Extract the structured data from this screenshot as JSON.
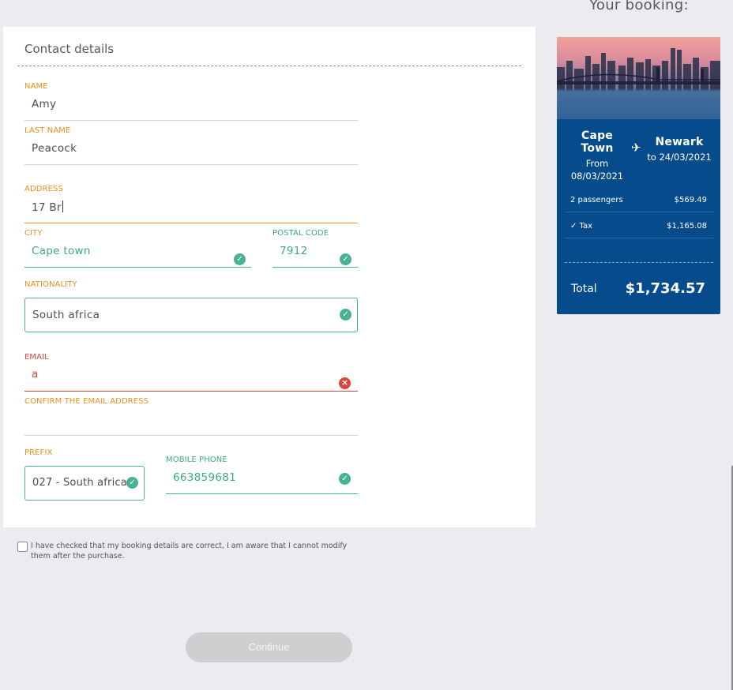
{
  "form": {
    "title": "Contact details",
    "name": {
      "label": "NAME",
      "value": "Amy"
    },
    "last_name": {
      "label": "LAST NAME",
      "value": "Peacock"
    },
    "address": {
      "label": "ADDRESS",
      "value": "17 Br"
    },
    "city": {
      "label": "CITY",
      "value": "Cape town"
    },
    "postal_code": {
      "label": "POSTAL CODE",
      "value": "7912"
    },
    "nationality": {
      "label": "NATIONALITY",
      "value": "South africa"
    },
    "email": {
      "label": "EMAIL",
      "value": "a"
    },
    "confirm_email": {
      "label": "CONFIRM THE EMAIL ADDRESS",
      "value": ""
    },
    "prefix": {
      "label": "PREFIX",
      "value": "027 - South africa"
    },
    "mobile_phone": {
      "label": "MOBILE PHONE",
      "value": "663859681"
    }
  },
  "terms": {
    "text": "I have checked that my booking details are correct, I am aware that I cannot modify them after the purchase.",
    "checked": false
  },
  "continue_label": "Continue",
  "booking": {
    "heading": "Your booking:",
    "from_city": "Cape Town",
    "from_label": "From",
    "from_date": "08/03/2021",
    "to_city": "Newark",
    "to_label": "to 24/03/2021",
    "passengers_label": "2 passengers",
    "passengers_price": "$569.49",
    "tax_label": "✓ Tax",
    "tax_price": "$1,165.08",
    "total_label": "Total",
    "total_price": "$1,734.57"
  },
  "icons": {
    "valid": "check-circle-icon",
    "error": "error-circle-icon",
    "plane": "airplane-icon"
  },
  "colors": {
    "accent_orange": "#e8901a",
    "valid_green": "#46b395",
    "error_red": "#d9463b",
    "card_blue": "#064c8c"
  }
}
